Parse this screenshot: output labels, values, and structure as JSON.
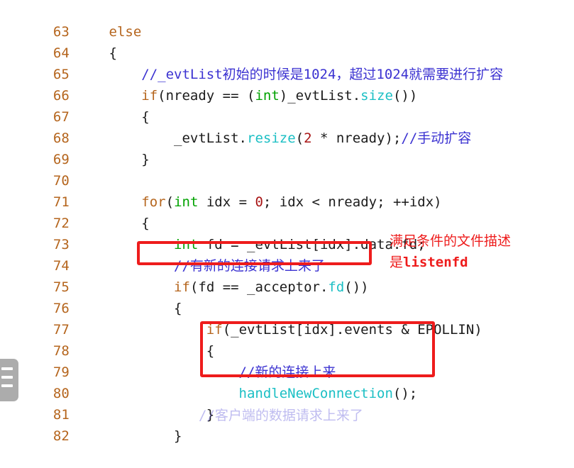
{
  "editor": {
    "language": "cpp",
    "background_color": "#ffffff",
    "line_number_color": "#b5651d",
    "theme_colors": {
      "keyword": "#b5651d",
      "type": "#00a200",
      "function": "#1bbfc4",
      "number": "#a81414",
      "comment": "#3b32d1",
      "plain": "#1b1b1b",
      "annotation": "#ee1c1c"
    },
    "lines": [
      {
        "number": "63",
        "indent": "    ",
        "text": "else"
      },
      {
        "number": "64",
        "indent": "    ",
        "text": "{"
      },
      {
        "number": "65",
        "indent": "        ",
        "text": "//_evtList初始的时候是1024，超过1024就需要进行扩容"
      },
      {
        "number": "66",
        "indent": "        ",
        "text": "if(nready == (int)_evtList.size())"
      },
      {
        "number": "67",
        "indent": "        ",
        "text": "{"
      },
      {
        "number": "68",
        "indent": "            ",
        "text": "_evtList.resize(2 * nready);//手动扩容"
      },
      {
        "number": "69",
        "indent": "        ",
        "text": "}"
      },
      {
        "number": "70",
        "indent": "",
        "text": ""
      },
      {
        "number": "71",
        "indent": "        ",
        "text": "for(int idx = 0; idx < nready; ++idx)"
      },
      {
        "number": "72",
        "indent": "        ",
        "text": "{"
      },
      {
        "number": "73",
        "indent": "            ",
        "text": "int fd = _evtList[idx].data.fd;"
      },
      {
        "number": "74",
        "indent": "            ",
        "text": "//有新的连接请求上来了"
      },
      {
        "number": "75",
        "indent": "            ",
        "text": "if(fd == _acceptor.fd())"
      },
      {
        "number": "76",
        "indent": "            ",
        "text": "{"
      },
      {
        "number": "77",
        "indent": "                ",
        "text": "if(_evtList[idx].events & EPOLLIN)"
      },
      {
        "number": "78",
        "indent": "                ",
        "text": "{"
      },
      {
        "number": "79",
        "indent": "                    ",
        "text": "//新的连接上来"
      },
      {
        "number": "80",
        "indent": "                    ",
        "text": "handleNewConnection();"
      },
      {
        "number": "81",
        "indent": "                ",
        "text": "}"
      },
      {
        "number": "82",
        "indent": "            ",
        "text": "}"
      }
    ]
  },
  "annotations": {
    "note": {
      "line_1": "满足条件的文件描述",
      "line_2_prefix": "是",
      "line_2_mono": "listenfd",
      "color": "#ee1c1c"
    },
    "box_if_condition": {
      "target_line": "75",
      "target_text": "if(fd == _acceptor.fd())"
    },
    "box_handler": {
      "target_lines": "79-80",
      "target_text": "//新的连接上来 handleNewConnection();"
    }
  },
  "watermark": {
    "icon": "list-lines-icon"
  },
  "clipped_bottom_line": {
    "text": "//客户端的数据请求上来了"
  }
}
